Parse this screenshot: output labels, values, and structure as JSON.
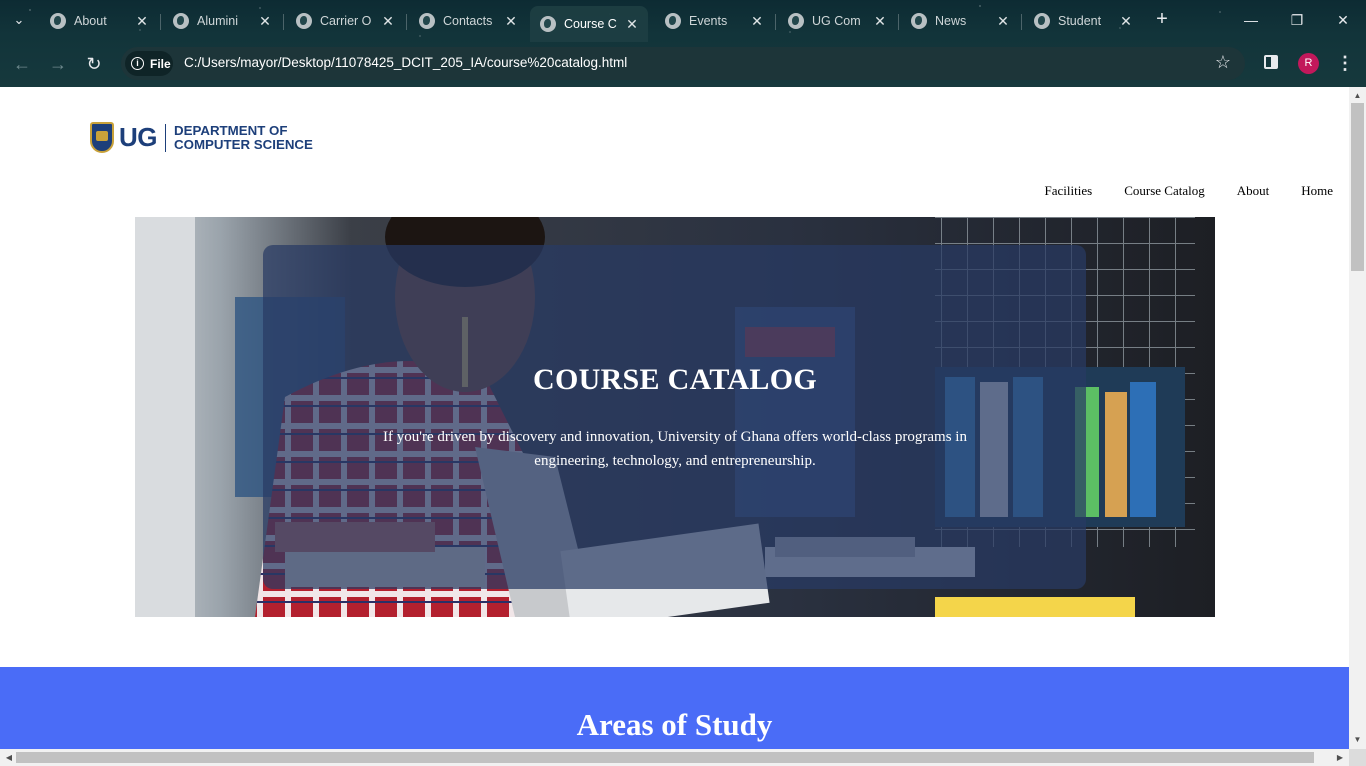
{
  "browser": {
    "tabs": [
      {
        "title": "About",
        "active": false
      },
      {
        "title": "Alumini",
        "active": false
      },
      {
        "title": "Carrier O",
        "active": false
      },
      {
        "title": "Contacts",
        "active": false
      },
      {
        "title": "Course C",
        "active": true
      },
      {
        "title": "Events",
        "active": false
      },
      {
        "title": "UG Com",
        "active": false
      },
      {
        "title": "News",
        "active": false
      },
      {
        "title": "Student",
        "active": false
      }
    ],
    "site_chip": "File",
    "url": "C:/Users/mayor/Desktop/11078425_DCIT_205_IA/course%20catalog.html",
    "profile_initial": "R",
    "icons": {
      "tab_list": "chevron-down-icon",
      "tab_favicon": "globe-icon",
      "tab_close": "close-icon",
      "new_tab": "plus-icon",
      "back": "arrow-left-icon",
      "forward": "arrow-right-icon",
      "reload": "reload-icon",
      "info": "info-icon",
      "bookmark": "star-icon",
      "side_panel": "side-panel-icon",
      "menu": "kebab-menu-icon",
      "minimize": "minimize-icon",
      "restore": "restore-icon",
      "close_window": "close-icon"
    }
  },
  "page": {
    "logo": {
      "abbr": "UG",
      "line1": "DEPARTMENT OF",
      "line2": "COMPUTER SCIENCE"
    },
    "nav": [
      "Facilities",
      "Course Catalog",
      "About",
      "Home"
    ],
    "hero": {
      "title": "COURSE CATALOG",
      "text": "If you're driven by discovery and innovation, University of Ghana offers world-class programs in engineering, technology, and entrepreneurship."
    },
    "areas": {
      "title": "Areas of Study",
      "background": "#4a6cf7"
    }
  }
}
